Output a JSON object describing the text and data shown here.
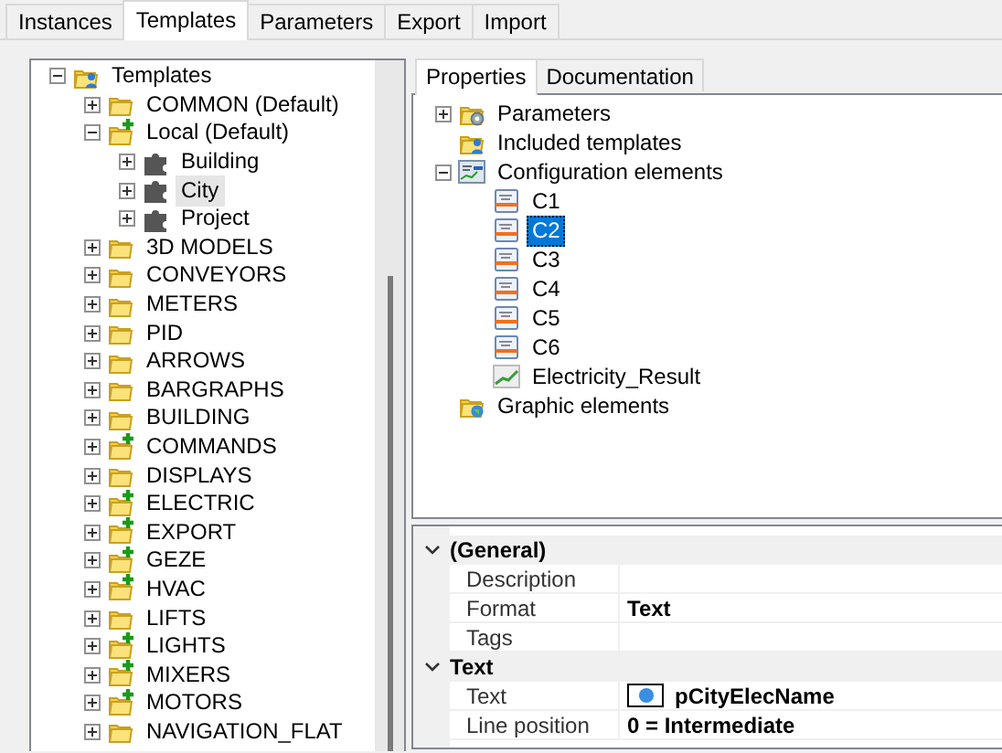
{
  "tabs": [
    {
      "label": "Instances",
      "selected": false
    },
    {
      "label": "Templates",
      "selected": true
    },
    {
      "label": "Parameters",
      "selected": false
    },
    {
      "label": "Export",
      "selected": false
    },
    {
      "label": "Import",
      "selected": false
    }
  ],
  "template_tree": {
    "focused": false,
    "items": [
      {
        "label": "Templates",
        "kind": "root",
        "expanded": true,
        "selected": false,
        "children": [
          {
            "label": "COMMON (Default)",
            "kind": "folder",
            "expanded": false,
            "selected": false
          },
          {
            "label": "Local (Default)",
            "kind": "folder-new",
            "expanded": true,
            "selected": false,
            "children": [
              {
                "label": "Building",
                "kind": "component",
                "expanded": false,
                "selected": false
              },
              {
                "label": "City",
                "kind": "component",
                "expanded": false,
                "selected": true
              },
              {
                "label": "Project",
                "kind": "component",
                "expanded": false,
                "selected": false
              }
            ]
          },
          {
            "label": "3D MODELS",
            "kind": "folder",
            "expanded": false,
            "selected": false
          },
          {
            "label": "CONVEYORS",
            "kind": "folder",
            "expanded": false,
            "selected": false
          },
          {
            "label": "METERS",
            "kind": "folder",
            "expanded": false,
            "selected": false
          },
          {
            "label": "PID",
            "kind": "folder",
            "expanded": false,
            "selected": false
          },
          {
            "label": "ARROWS",
            "kind": "folder",
            "expanded": false,
            "selected": false
          },
          {
            "label": "BARGRAPHS",
            "kind": "folder",
            "expanded": false,
            "selected": false
          },
          {
            "label": "BUILDING",
            "kind": "folder",
            "expanded": false,
            "selected": false
          },
          {
            "label": "COMMANDS",
            "kind": "folder-new",
            "expanded": false,
            "selected": false
          },
          {
            "label": "DISPLAYS",
            "kind": "folder",
            "expanded": false,
            "selected": false
          },
          {
            "label": "ELECTRIC",
            "kind": "folder-new",
            "expanded": false,
            "selected": false
          },
          {
            "label": "EXPORT",
            "kind": "folder-new",
            "expanded": false,
            "selected": false
          },
          {
            "label": "GEZE",
            "kind": "folder-new",
            "expanded": false,
            "selected": false
          },
          {
            "label": "HVAC",
            "kind": "folder-new",
            "expanded": false,
            "selected": false
          },
          {
            "label": "LIFTS",
            "kind": "folder",
            "expanded": false,
            "selected": false
          },
          {
            "label": "LIGHTS",
            "kind": "folder-new",
            "expanded": false,
            "selected": false
          },
          {
            "label": "MIXERS",
            "kind": "folder-new",
            "expanded": false,
            "selected": false
          },
          {
            "label": "MOTORS",
            "kind": "folder-new",
            "expanded": false,
            "selected": false
          },
          {
            "label": "NAVIGATION_FLAT",
            "kind": "folder",
            "expanded": false,
            "selected": false
          }
        ]
      }
    ]
  },
  "detail_tabs": [
    {
      "label": "Properties",
      "selected": true
    },
    {
      "label": "Documentation",
      "selected": false
    }
  ],
  "element_tree": {
    "focused": true,
    "items": [
      {
        "label": "Parameters",
        "kind": "param-folder",
        "expanded": false,
        "selected": false
      },
      {
        "label": "Included templates",
        "kind": "root",
        "selected": false
      },
      {
        "label": "Configuration elements",
        "kind": "config",
        "expanded": true,
        "selected": false,
        "children": [
          {
            "label": "C1",
            "kind": "element",
            "selected": false
          },
          {
            "label": "C2",
            "kind": "element",
            "selected": true
          },
          {
            "label": "C3",
            "kind": "element",
            "selected": false
          },
          {
            "label": "C4",
            "kind": "element",
            "selected": false
          },
          {
            "label": "C5",
            "kind": "element",
            "selected": false
          },
          {
            "label": "C6",
            "kind": "element",
            "selected": false
          },
          {
            "label": "Electricity_Result",
            "kind": "chart",
            "selected": false
          }
        ]
      },
      {
        "label": "Graphic elements",
        "kind": "graphic-folder",
        "selected": false
      }
    ]
  },
  "property_grid": [
    {
      "category": "(General)",
      "expanded": true,
      "rows": [
        {
          "label": "Description"
        },
        {
          "label": "Format",
          "value": "Text"
        },
        {
          "label": "Tags"
        }
      ]
    },
    {
      "category": "Text",
      "expanded": true,
      "rows": [
        {
          "label": "Text",
          "value": "pCityElecName",
          "kind": "expression"
        },
        {
          "label": "Line position",
          "value": "0 = Intermediate"
        }
      ]
    }
  ]
}
